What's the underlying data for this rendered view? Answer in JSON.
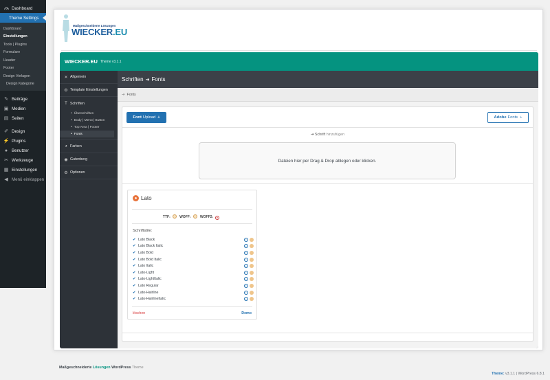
{
  "wp_menu": {
    "dashboard": "Dashboard",
    "theme_settings": "Theme Settings",
    "submenu": [
      "Dashboard",
      "Einstellungen",
      "Tools | Plugins",
      "Formulare",
      "Header",
      "Footer",
      "Design Vorlagen",
      "Design Kategorie"
    ],
    "items": [
      {
        "icon": "pin-icon",
        "label": "Beiträge"
      },
      {
        "icon": "media-icon",
        "label": "Medien"
      },
      {
        "icon": "pages-icon",
        "label": "Seiten"
      },
      {
        "icon": "brush-icon",
        "label": "Design"
      },
      {
        "icon": "plugin-icon",
        "label": "Plugins"
      },
      {
        "icon": "users-icon",
        "label": "Benutzer"
      },
      {
        "icon": "wrench-icon",
        "label": "Werkzeuge"
      },
      {
        "icon": "settings-icon",
        "label": "Einstellungen"
      },
      {
        "icon": "collapse-icon",
        "label": "Menü einklappen"
      }
    ]
  },
  "logo": {
    "tagline": "Maßgeschneiderte Lösungen",
    "name_a": "WIECKER",
    "name_b": ".EU"
  },
  "theme_bar": {
    "brand": "WIECKER.EU",
    "version": "Theme v3.1.1"
  },
  "theme_nav": {
    "allgemein": "Allgemein",
    "template": "Template Einstellungen",
    "schriften": "Schriften",
    "schriften_subs": [
      "Überschriften",
      "Body | Menü | Button",
      "Top Area | Footer",
      "Fonts"
    ],
    "farben": "Farben",
    "gutenberg": "Gutenberg",
    "optionen": "Optionen"
  },
  "header": {
    "section": "Schriften",
    "page": "Fonts",
    "crumb": "Fonts"
  },
  "toolbar": {
    "upload_bold": "Font",
    "upload_light": "Upload",
    "adobe_bold": "Adobe",
    "adobe_light": "Fonts"
  },
  "upload": {
    "add_bold": "Schrift",
    "add_light": "hinzufügen",
    "dropzone": "Dateien hier per Drag & Drop ablegen oder klicken."
  },
  "font_card": {
    "name": "Lato",
    "formats": [
      "TTF:",
      "WOFF:",
      "WOFF2:"
    ],
    "styles_label": "Schriftstile:",
    "styles": [
      "Lato Black",
      "Lato Black Italic",
      "Lato Bold",
      "Lato Bold Italic",
      "Lato Italic",
      "Lato-Light",
      "Lato-LightItalic",
      "Lato Regular",
      "Lato-Hairline",
      "Lato-HairlineItalic"
    ],
    "delete": "löschen",
    "demo": "Demo"
  },
  "footer": {
    "left_a": "Maßgeschneiderte",
    "left_b": "Lösungen",
    "left_c": "WordPress",
    "left_d": "Theme",
    "right_a": "Theme:",
    "right_b": "v3.1.1",
    "right_c": "|",
    "right_d": "WordPress 6.8.1"
  },
  "colors": {
    "teal": "#059380",
    "wp_blue": "#2271b1",
    "sidebar_dark": "#1d2327"
  }
}
